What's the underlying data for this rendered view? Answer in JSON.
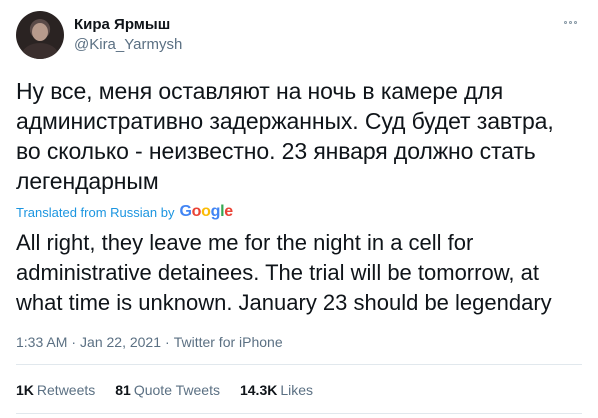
{
  "author": {
    "display_name": "Кира Ярмыш",
    "handle": "@Kira_Yarmysh"
  },
  "tweet": {
    "text": "Ну все, меня оставляют на ночь в камере для административно задержанных. Суд будет завтра, во сколько - неизвестно. 23 января должно стать легендарным",
    "translated_label": "Translated from Russian by",
    "translation_provider": "Google",
    "translation": "All right, they leave me for the night in a cell for administrative detainees. The trial will be tomorrow, at what time is unknown. January 23 should be legendary"
  },
  "meta": {
    "time": "1:33 AM",
    "date": "Jan 22, 2021",
    "source": "Twitter for iPhone",
    "separator": "·"
  },
  "stats": {
    "retweets_count": "1K",
    "retweets_label": "Retweets",
    "quote_tweets_count": "81",
    "quote_tweets_label": "Quote Tweets",
    "likes_count": "14.3K",
    "likes_label": "Likes"
  },
  "icons": {
    "more": "more-options-icon"
  },
  "colors": {
    "text": "#0f1419",
    "secondary": "#5b7083",
    "link": "#1b95e0",
    "divider": "#e1e8ed"
  }
}
